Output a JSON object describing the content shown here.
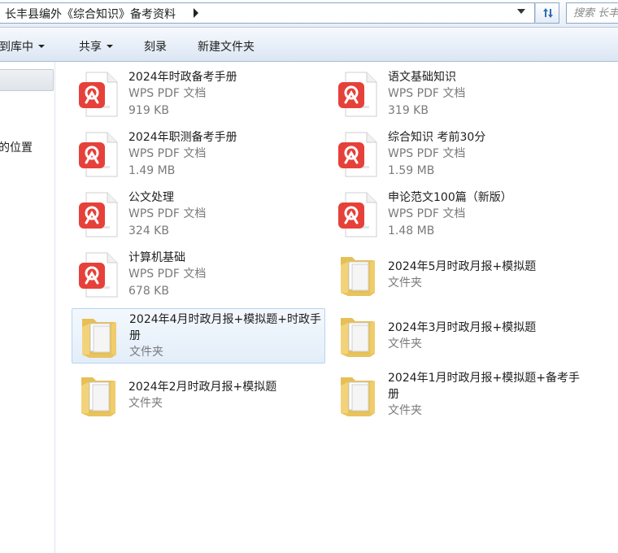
{
  "address": {
    "path": "长丰县编外《综合知识》备考资料",
    "search_placeholder": "搜索 长丰"
  },
  "toolbar": {
    "items": [
      "到库中",
      "共享",
      "刻录",
      "新建文件夹"
    ]
  },
  "nav": {
    "label": "的位置"
  },
  "files": [
    {
      "name": "2024年时政备考手册",
      "type": "WPS PDF 文档",
      "size": "919 KB",
      "kind": "pdf"
    },
    {
      "name": "语文基础知识",
      "type": "WPS PDF 文档",
      "size": "319 KB",
      "kind": "pdf"
    },
    {
      "name": "2024年职测备考手册",
      "type": "WPS PDF 文档",
      "size": "1.49 MB",
      "kind": "pdf"
    },
    {
      "name": "综合知识 考前30分",
      "type": "WPS PDF 文档",
      "size": "1.59 MB",
      "kind": "pdf"
    },
    {
      "name": "公文处理",
      "type": "WPS PDF 文档",
      "size": "324 KB",
      "kind": "pdf"
    },
    {
      "name": "申论范文100篇（新版）",
      "type": "WPS PDF 文档",
      "size": "1.48 MB",
      "kind": "pdf"
    },
    {
      "name": "计算机基础",
      "type": "WPS PDF 文档",
      "size": "678 KB",
      "kind": "pdf"
    },
    {
      "name": "2024年5月时政月报+模拟题",
      "type": "文件夹",
      "size": "",
      "kind": "folder"
    },
    {
      "name": "2024年4月时政月报+模拟题+时政手册",
      "type": "文件夹",
      "size": "",
      "kind": "folder",
      "selected": true
    },
    {
      "name": "2024年3月时政月报+模拟题",
      "type": "文件夹",
      "size": "",
      "kind": "folder"
    },
    {
      "name": "2024年2月时政月报+模拟题",
      "type": "文件夹",
      "size": "",
      "kind": "folder"
    },
    {
      "name": "2024年1月时政月报+模拟题+备考手册",
      "type": "文件夹",
      "size": "",
      "kind": "folder"
    }
  ],
  "colors": {
    "pdf_red": "#e5413a",
    "folder_yellow": "#f3d37a",
    "selection": "#dceaf9"
  },
  "icons": {
    "pdf": "wps-pdf-icon",
    "folder": "folder-icon"
  }
}
